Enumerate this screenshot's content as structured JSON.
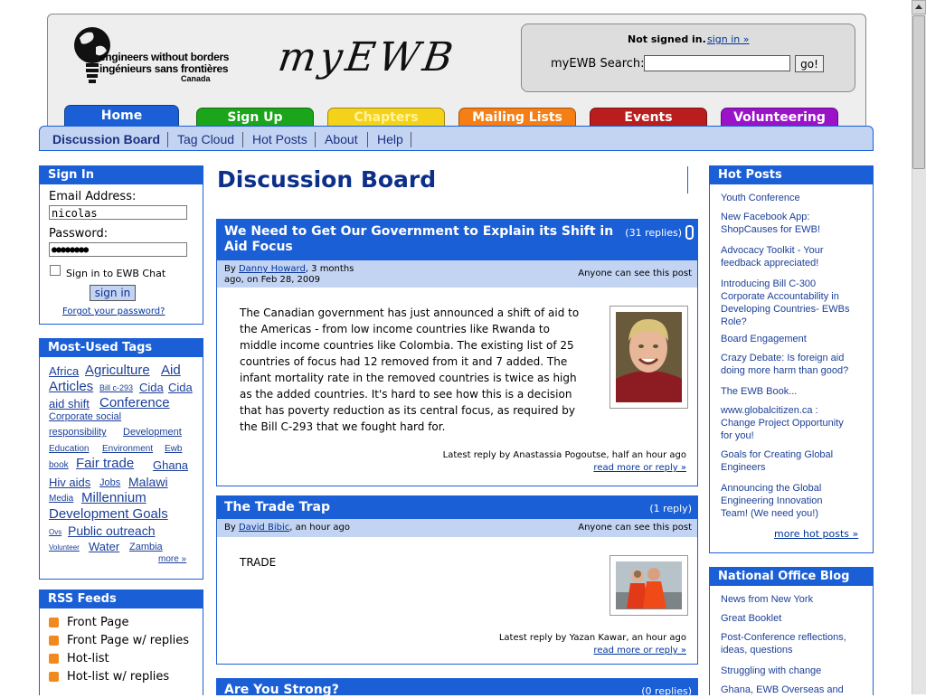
{
  "header": {
    "logo_line1": "engineers without borders",
    "logo_line2": "ingénieurs sans frontières",
    "logo_line3": "Canada",
    "brand": "myEWB",
    "not_signed_in": "Not signed in.",
    "sign_in_link": "sign in »",
    "search_label": "myEWB Search:",
    "search_value": "",
    "go_label": "go!"
  },
  "tabs": [
    "Home",
    "Sign Up",
    "Chapters",
    "Mailing Lists",
    "Events",
    "Volunteering"
  ],
  "subnav": [
    "Discussion Board",
    "Tag Cloud",
    "Hot Posts",
    "About",
    "Help"
  ],
  "signin": {
    "title": "Sign In",
    "email_label": "Email Address:",
    "email_value": "nicolas",
    "password_label": "Password:",
    "password_value": "●●●●●●●●",
    "chat_label": "Sign in to EWB Chat",
    "button": "sign in",
    "forgot": "Forgot your password?"
  },
  "tags": {
    "title": "Most-Used Tags",
    "items": [
      "Africa",
      "Agriculture",
      "Aid",
      "Articles",
      "Bill c-293",
      "Cida",
      "Cida",
      "aid shift",
      "Conference",
      "Corporate social",
      "responsibility",
      "Development",
      "Education",
      "Environment",
      "Ewb",
      "book",
      "Fair trade",
      "Ghana",
      "Hiv aids",
      "Jobs",
      "Malawi",
      "Media",
      "Millennium",
      "Development Goals",
      "Ovs",
      "Public outreach",
      "Volunteer",
      "Water",
      "Zambia"
    ],
    "more": "more »"
  },
  "rss": {
    "title": "RSS Feeds",
    "items": [
      "Front Page",
      "Front Page w/ replies",
      "Hot-list",
      "Hot-list w/ replies"
    ]
  },
  "main": {
    "title": "Discussion Board",
    "posts": [
      {
        "title_line1": "We Need to Get Our Government to Explain its Shift in",
        "title_line2": "Aid Focus",
        "replies": "(31 replies)",
        "by": "By",
        "author": "Danny Howard",
        "date_line1": ", 3 months",
        "date_line2": "ago, on Feb 28, 2009",
        "visibility": "Anyone can see this post",
        "body": [
          "The Canadian government has just announced a shift of aid to",
          "the Americas - from low income countries like Rwanda to",
          "middle income countries like Colombia. The existing list of 25",
          "countries of focus had 12 removed from it and 7 added. The",
          "infant mortality rate in the removed countries is twice as high",
          "as the added countries. It's hard to see how this is a decision",
          "that has poverty reduction as its central focus, as required by",
          "the Bill C-293 that we fought hard for."
        ],
        "latest": "Latest reply by Anastassia Pogoutse, half an hour ago",
        "read_more": "read more or reply »"
      },
      {
        "title_line1": "The Trade Trap",
        "replies": "(1 reply)",
        "by": "By",
        "author": "David Bibic",
        "date_line1": ", an hour ago",
        "visibility": "Anyone can see this post",
        "body": [
          "TRADE"
        ],
        "latest": "Latest reply by Yazan Kawar, an hour ago",
        "read_more": "read more or reply »"
      },
      {
        "title_line1": "Are You Strong?",
        "replies": "(0 replies)"
      }
    ]
  },
  "hot_posts": {
    "title": "Hot Posts",
    "items": [
      [
        "Youth Conference"
      ],
      [
        "New Facebook App:",
        "ShopCauses for EWB!"
      ],
      [
        "Advocacy Toolkit - Your",
        "feedback appreciated!"
      ],
      [
        "Introducing Bill C-300",
        "Corporate Accountability in",
        "Developing Countries- EWBs",
        "Role?"
      ],
      [
        "Board Engagement"
      ],
      [
        "Crazy Debate: Is foreign aid",
        "doing more harm than good?"
      ],
      [
        "The EWB Book..."
      ],
      [
        "www.globalcitizen.ca :",
        "Change Project Opportunity",
        "for you!"
      ],
      [
        "Goals for Creating Global",
        "Engineers"
      ],
      [
        "Announcing the Global",
        "Engineering Innovation",
        "Team! (We need you!)"
      ]
    ],
    "more": "more hot posts »"
  },
  "blog": {
    "title": "National Office Blog",
    "items": [
      [
        "News from New York"
      ],
      [
        "Great Booklet"
      ],
      [
        "Post-Conference reflections,",
        "ideas, questions"
      ],
      [
        "Struggling with change"
      ],
      [
        "Ghana, EWB Overseas and"
      ]
    ]
  },
  "colors": {
    "primary_blue": "#1b5fd6",
    "light_blue": "#c3d4f3",
    "tab_green": "#1aa51a",
    "tab_yellow": "#f5d21a",
    "tab_orange": "#f57f14",
    "tab_red": "#b91d1d",
    "tab_purple": "#9a13c8"
  }
}
